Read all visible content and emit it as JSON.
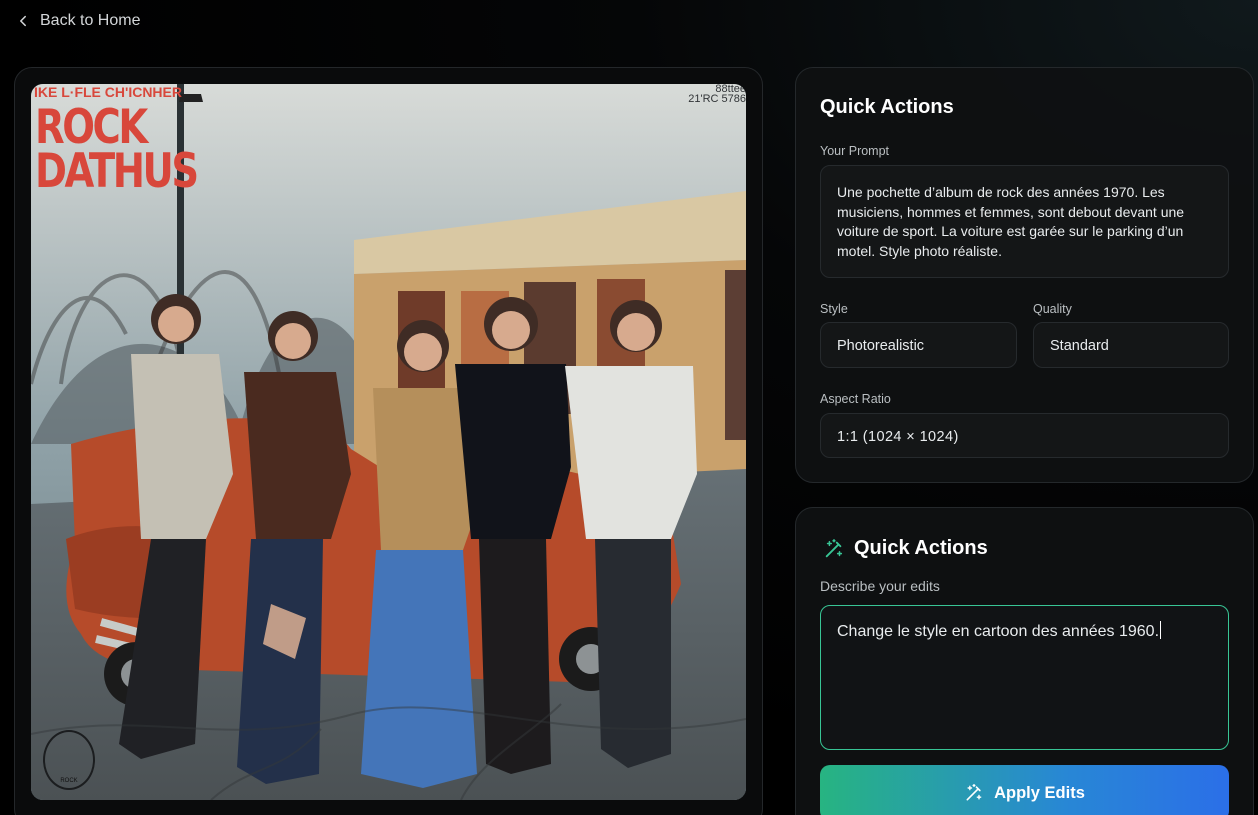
{
  "navigation": {
    "back_label": "Back to Home"
  },
  "image": {
    "album_top": "IKE L·FLE CH'ICNHER",
    "album_title_line1": "ROCK",
    "album_title_line2": "DATHUS",
    "album_code_line1": "88ttee",
    "album_code_line2": "21'RC 5786",
    "seal_text": "ROCK"
  },
  "quick_actions": {
    "title": "Quick Actions",
    "prompt_label": "Your Prompt",
    "prompt_value": "Une pochette d’album de rock des années 1970. Les musiciens, hommes et femmes, sont debout devant une voiture de sport. La voiture est garée sur le parking d’un motel. Style photo réaliste.",
    "style_label": "Style",
    "style_value": "Photorealistic",
    "quality_label": "Quality",
    "quality_value": "Standard",
    "aspect_label": "Aspect Ratio",
    "aspect_value": "1:1 (1024 × 1024)"
  },
  "edit_panel": {
    "title": "Quick Actions",
    "describe_label": "Describe your edits",
    "edit_value": "Change le style en cartoon des années 1960.",
    "apply_label": "Apply Edits"
  },
  "icons": {
    "back": "chevron-left-icon",
    "edit": "magic-wand-icon",
    "apply": "magic-wand-icon"
  },
  "colors": {
    "accent_green": "#38c595",
    "accent_blue": "#2b6fe8",
    "album_red": "#d8473b"
  }
}
